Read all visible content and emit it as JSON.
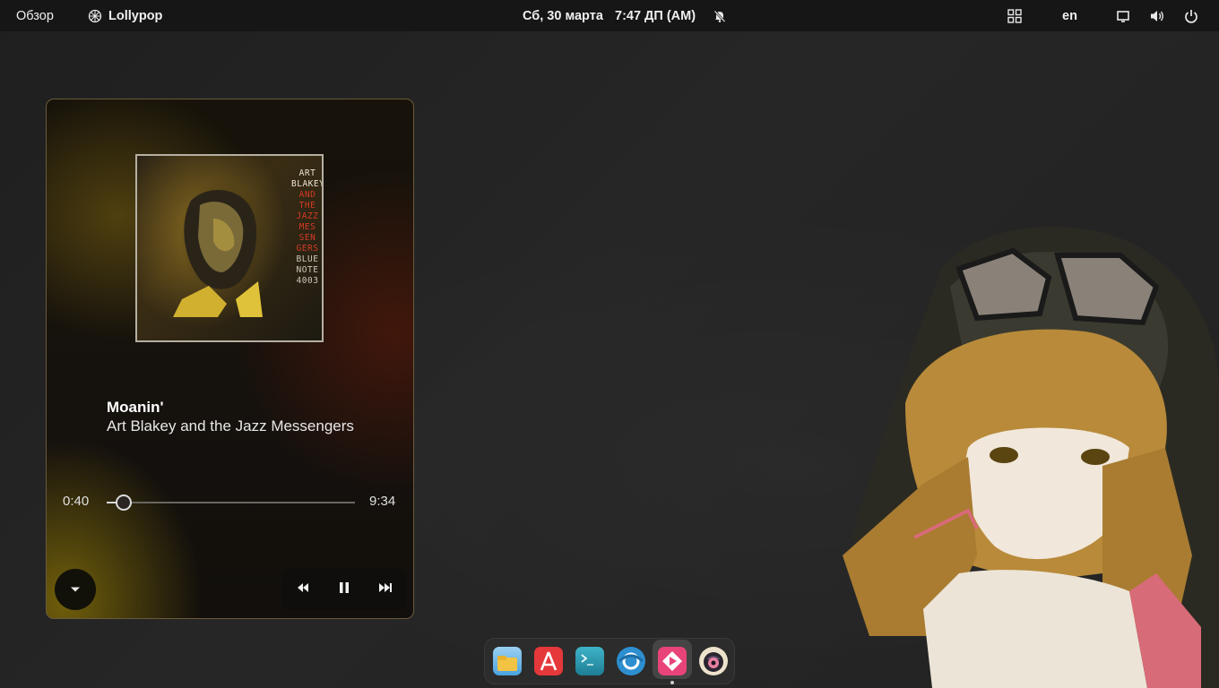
{
  "topbar": {
    "overview_label": "Обзор",
    "app_name": "Lollypop",
    "date": "Сб, 30 марта",
    "time": "7:47 ДП (AM)",
    "language": "en",
    "icons": [
      "lollypop-app-icon",
      "notifications-muted-icon",
      "grid-icon",
      "screen-icon",
      "volume-icon",
      "power-icon"
    ]
  },
  "player": {
    "album": {
      "cover_lines_white": [
        "ART",
        "BLAKEY"
      ],
      "cover_lines_red": [
        "AND",
        "THE",
        "JAZZ",
        "MES",
        "SEN",
        "GERS"
      ],
      "cover_lines_grey": [
        "BLUE",
        "NOTE",
        "4003"
      ]
    },
    "track_title": "Moanin'",
    "track_artist": "Art Blakey and the Jazz Messengers",
    "position": "0:40",
    "duration": "9:34",
    "progress": 0.07,
    "controls": [
      "rewind-icon",
      "pause-icon",
      "skip-forward-icon"
    ],
    "collapse_icon": "chevron-down-icon"
  },
  "dock": {
    "apps": [
      "files-icon",
      "app-store-icon",
      "terminal-icon",
      "browser-icon",
      "media-player-icon",
      "anime-app-icon"
    ],
    "active_app": "media-player-icon"
  },
  "colors": {
    "topbar_bg": "#161616",
    "desktop_bg": "#232323",
    "player_border": "#6b5a3a",
    "accent_red": "#d43a25"
  }
}
